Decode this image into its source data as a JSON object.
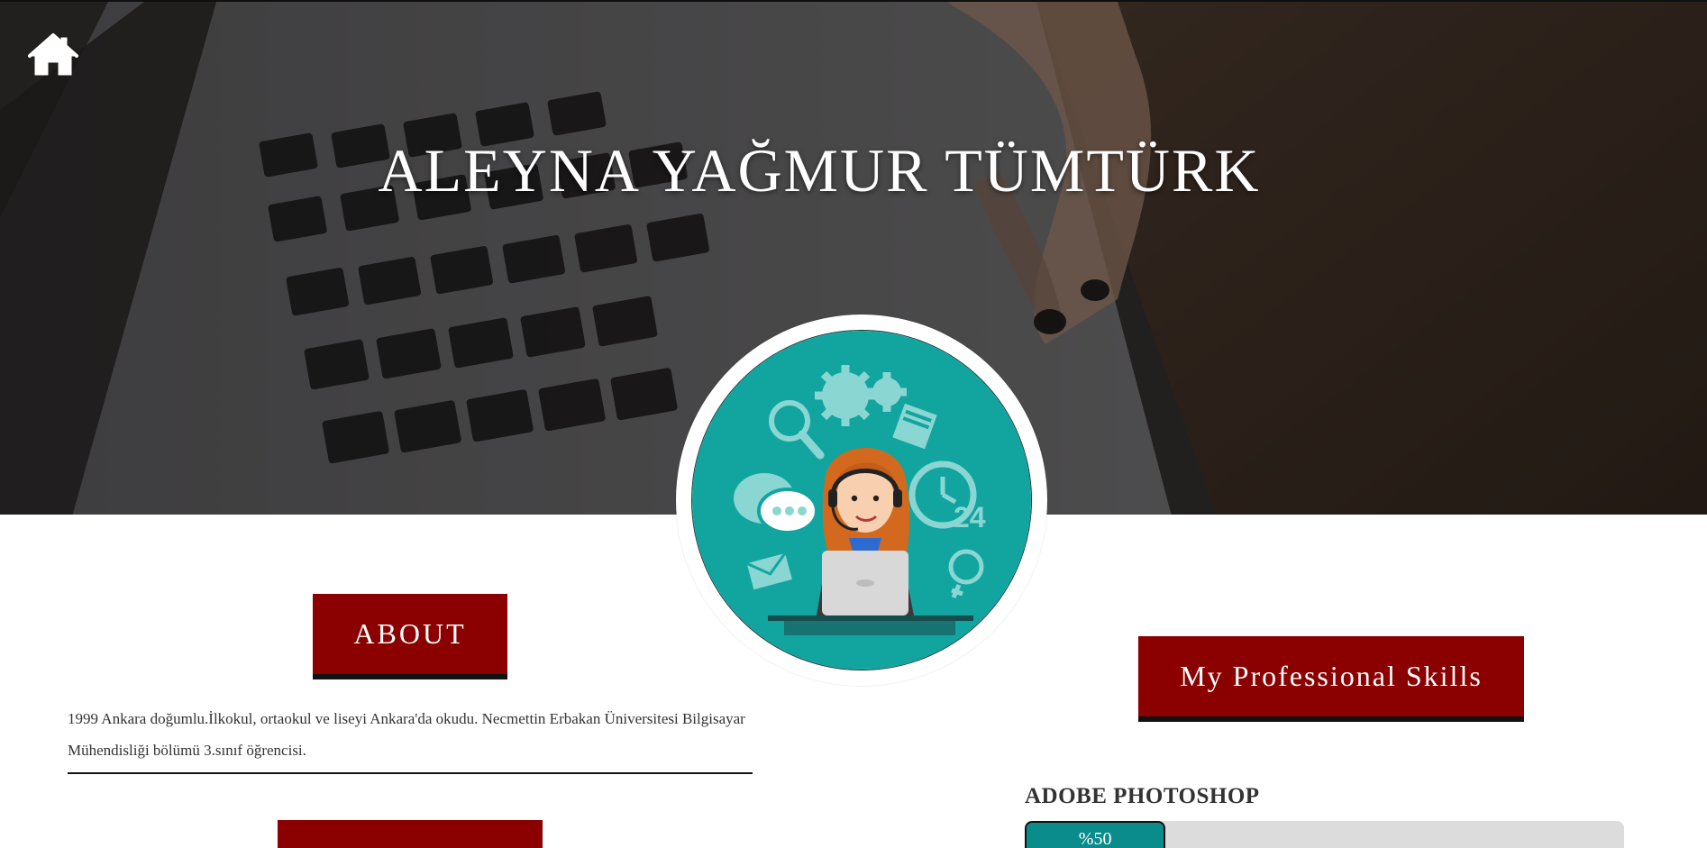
{
  "hero": {
    "title": "ALEYNA YAĞMUR TÜMTÜRK"
  },
  "icons": {
    "home": "home-icon",
    "avatar": "customer-support-avatar"
  },
  "about": {
    "heading": "ABOUT",
    "text": "1999 Ankara doğumlu.İlkokul, ortaokul ve liseyi Ankara'da okudu. Necmettin Erbakan Üniversitesi Bilgisayar Mühendisliği bölümü 3.sınıf öğrencisi."
  },
  "skills": {
    "heading": "My Professional Skills",
    "items": [
      {
        "name": "ADOBE PHOTOSHOP",
        "label": "%50",
        "percent": 50
      }
    ]
  },
  "colors": {
    "accent": "#8b0000",
    "progress": "#0a8c8c",
    "avatar_bg": "#12a5a0"
  }
}
